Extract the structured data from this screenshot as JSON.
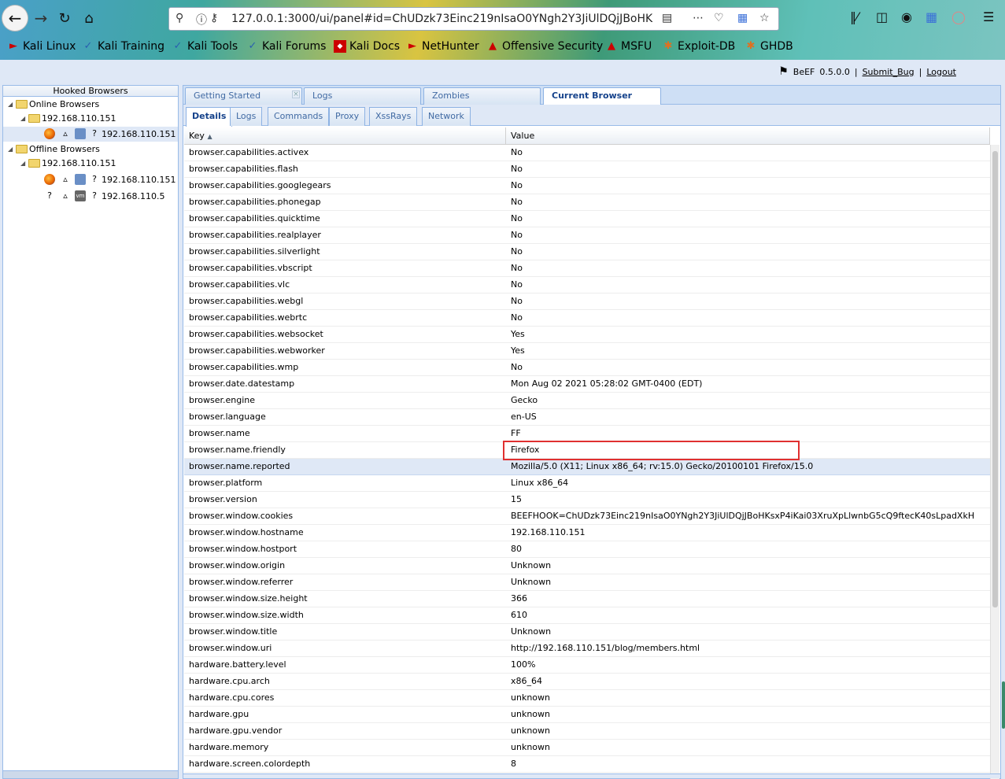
{
  "browser": {
    "url": "127.0.0.1:3000/ui/panel#id=ChUDzk73Einc219nIsaO0YNgh2Y3JiUlDQjJBoHK",
    "bookmarks": [
      "Kali Linux",
      "Kali Training",
      "Kali Tools",
      "Kali Forums",
      "Kali Docs",
      "NetHunter",
      "Offensive Security",
      "MSFU",
      "Exploit-DB",
      "GHDB"
    ]
  },
  "header": {
    "app": "BeEF",
    "version": "0.5.0.0",
    "separator": "|",
    "submit_bug": "Submit_Bug",
    "logout": "Logout"
  },
  "left": {
    "title": "Hooked Browsers",
    "online_label": "Online Browsers",
    "online_subnet": "192.168.110.151",
    "online_host": "192.168.110.151",
    "offline_label": "Offline Browsers",
    "offline_subnet": "192.168.110.151",
    "offline_host1": "192.168.110.151",
    "offline_host2": "192.168.110.5",
    "unknown": "?"
  },
  "tabs": {
    "getting_started": "Getting Started",
    "logs": "Logs",
    "zombies": "Zombies",
    "current_browser": "Current Browser"
  },
  "subtabs": {
    "details": "Details",
    "logs": "Logs",
    "commands": "Commands",
    "proxy": "Proxy",
    "xssrays": "XssRays",
    "network": "Network"
  },
  "grid": {
    "col_key": "Key",
    "col_value": "Value",
    "rows": [
      {
        "k": "browser.capabilities.activex",
        "v": "No"
      },
      {
        "k": "browser.capabilities.flash",
        "v": "No"
      },
      {
        "k": "browser.capabilities.googlegears",
        "v": "No"
      },
      {
        "k": "browser.capabilities.phonegap",
        "v": "No"
      },
      {
        "k": "browser.capabilities.quicktime",
        "v": "No"
      },
      {
        "k": "browser.capabilities.realplayer",
        "v": "No"
      },
      {
        "k": "browser.capabilities.silverlight",
        "v": "No"
      },
      {
        "k": "browser.capabilities.vbscript",
        "v": "No"
      },
      {
        "k": "browser.capabilities.vlc",
        "v": "No"
      },
      {
        "k": "browser.capabilities.webgl",
        "v": "No"
      },
      {
        "k": "browser.capabilities.webrtc",
        "v": "No"
      },
      {
        "k": "browser.capabilities.websocket",
        "v": "Yes"
      },
      {
        "k": "browser.capabilities.webworker",
        "v": "Yes"
      },
      {
        "k": "browser.capabilities.wmp",
        "v": "No"
      },
      {
        "k": "browser.date.datestamp",
        "v": "Mon Aug 02 2021 05:28:02 GMT-0400 (EDT)"
      },
      {
        "k": "browser.engine",
        "v": "Gecko"
      },
      {
        "k": "browser.language",
        "v": "en-US"
      },
      {
        "k": "browser.name",
        "v": "FF"
      },
      {
        "k": "browser.name.friendly",
        "v": "Firefox"
      },
      {
        "k": "browser.name.reported",
        "v": "Mozilla/5.0 (X11; Linux x86_64; rv:15.0) Gecko/20100101 Firefox/15.0"
      },
      {
        "k": "browser.platform",
        "v": "Linux x86_64"
      },
      {
        "k": "browser.version",
        "v": "15"
      },
      {
        "k": "browser.window.cookies",
        "v": "BEEFHOOK=ChUDzk73Einc219nIsaO0YNgh2Y3JiUlDQjJBoHKsxP4iKai03XruXpLlwnbG5cQ9ftecK40sLpadXkH"
      },
      {
        "k": "browser.window.hostname",
        "v": "192.168.110.151"
      },
      {
        "k": "browser.window.hostport",
        "v": "80"
      },
      {
        "k": "browser.window.origin",
        "v": "Unknown"
      },
      {
        "k": "browser.window.referrer",
        "v": "Unknown"
      },
      {
        "k": "browser.window.size.height",
        "v": "366"
      },
      {
        "k": "browser.window.size.width",
        "v": "610"
      },
      {
        "k": "browser.window.title",
        "v": "Unknown"
      },
      {
        "k": "browser.window.uri",
        "v": "http://192.168.110.151/blog/members.html"
      },
      {
        "k": "hardware.battery.level",
        "v": "100%"
      },
      {
        "k": "hardware.cpu.arch",
        "v": "x86_64"
      },
      {
        "k": "hardware.cpu.cores",
        "v": "unknown"
      },
      {
        "k": "hardware.gpu",
        "v": "unknown"
      },
      {
        "k": "hardware.gpu.vendor",
        "v": "unknown"
      },
      {
        "k": "hardware.memory",
        "v": "unknown"
      },
      {
        "k": "hardware.screen.colordepth",
        "v": "8"
      }
    ]
  }
}
